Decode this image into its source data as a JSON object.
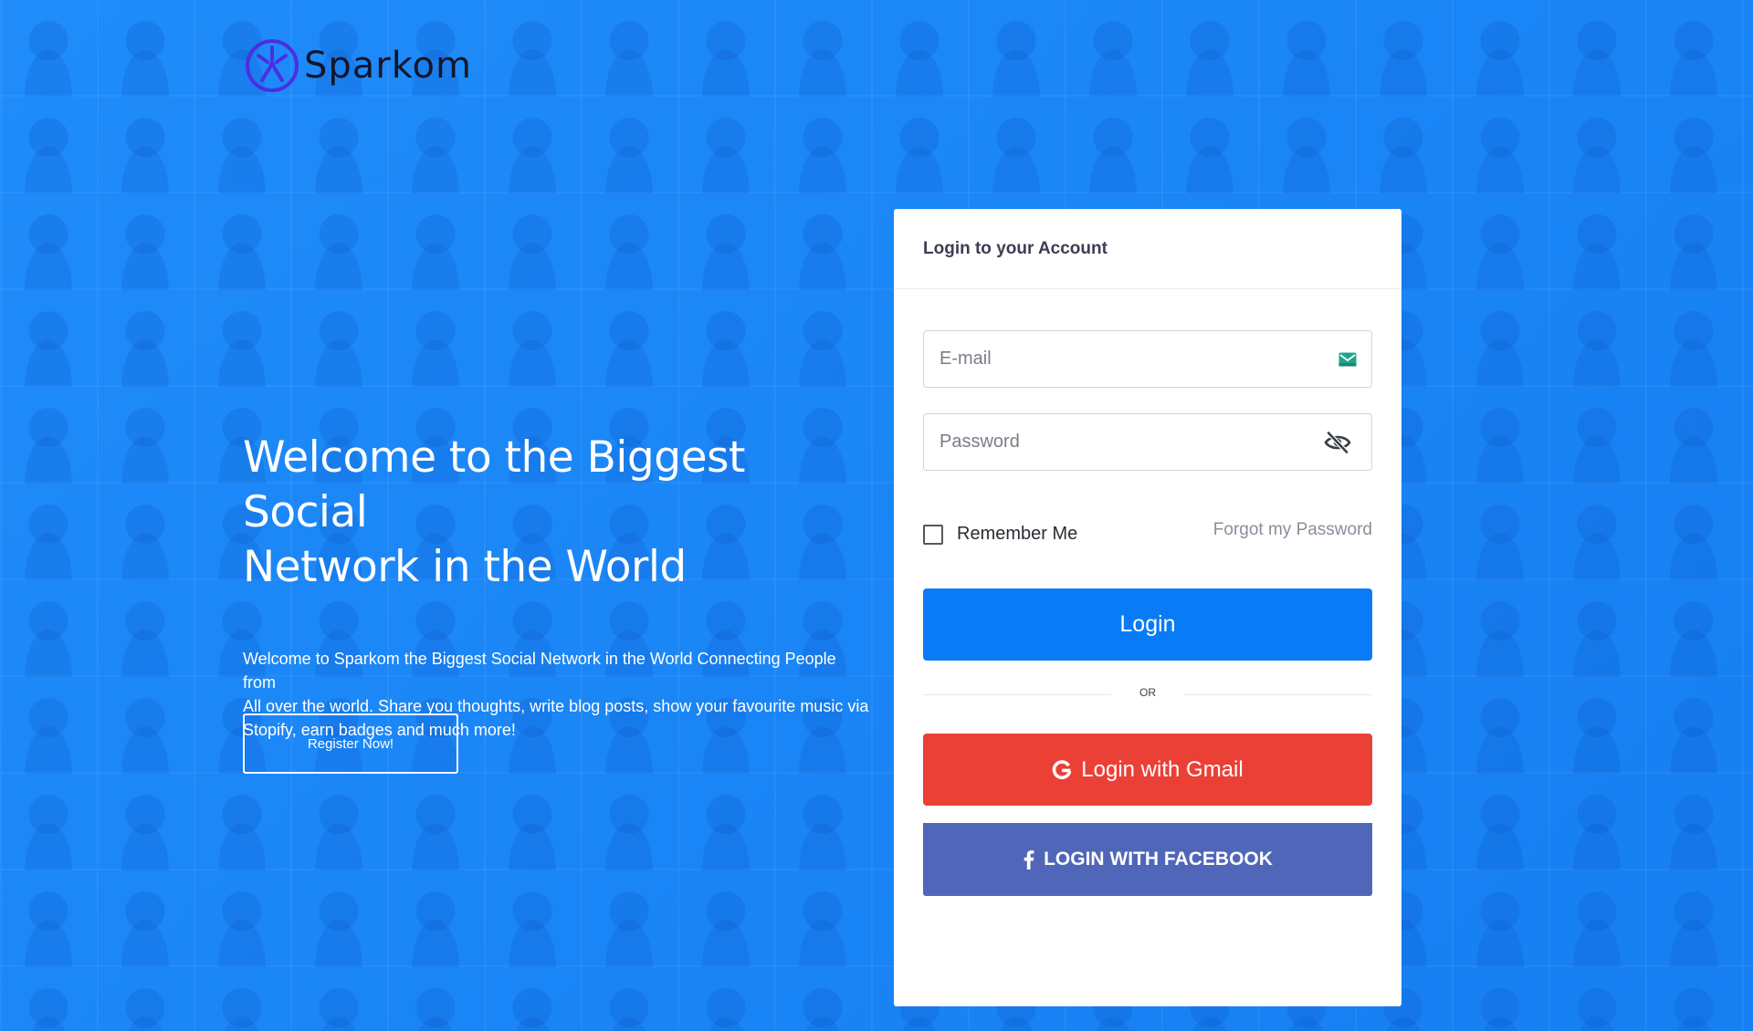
{
  "brand": {
    "name": "Sparkom"
  },
  "hero": {
    "title_line1": "Welcome to the Biggest Social",
    "title_line2": "Network in the World",
    "description_line1": "Welcome to Sparkom the Biggest Social Network in the World Connecting People from",
    "description_line2": "All over the world. Share you thoughts, write blog posts, show your favourite music via",
    "description_line3": "Stopify, earn badges and much more!",
    "register_label": "Register Now!"
  },
  "login": {
    "title": "Login to your Account",
    "email_placeholder": "E-mail",
    "email_value": "",
    "password_placeholder": "Password",
    "password_value": "",
    "remember_label": "Remember Me",
    "remember_checked": false,
    "forgot_label": "Forgot my Password",
    "login_label": "Login",
    "divider_label": "OR",
    "gmail_label": "Login with Gmail",
    "facebook_label": "LOGIN WITH FACEBOOK"
  },
  "icons": {
    "logo": "sparkom-logo-icon",
    "email": "mail-icon",
    "password": "eye-slash-icon",
    "gmail": "google-icon",
    "facebook": "facebook-icon"
  },
  "colors": {
    "background": "#1987f8",
    "primary": "#0a7bf6",
    "gmail": "#eb4036",
    "facebook": "#5066b8",
    "logo_icon": "#4a2fe0",
    "mail_icon": "#1fa58a"
  }
}
